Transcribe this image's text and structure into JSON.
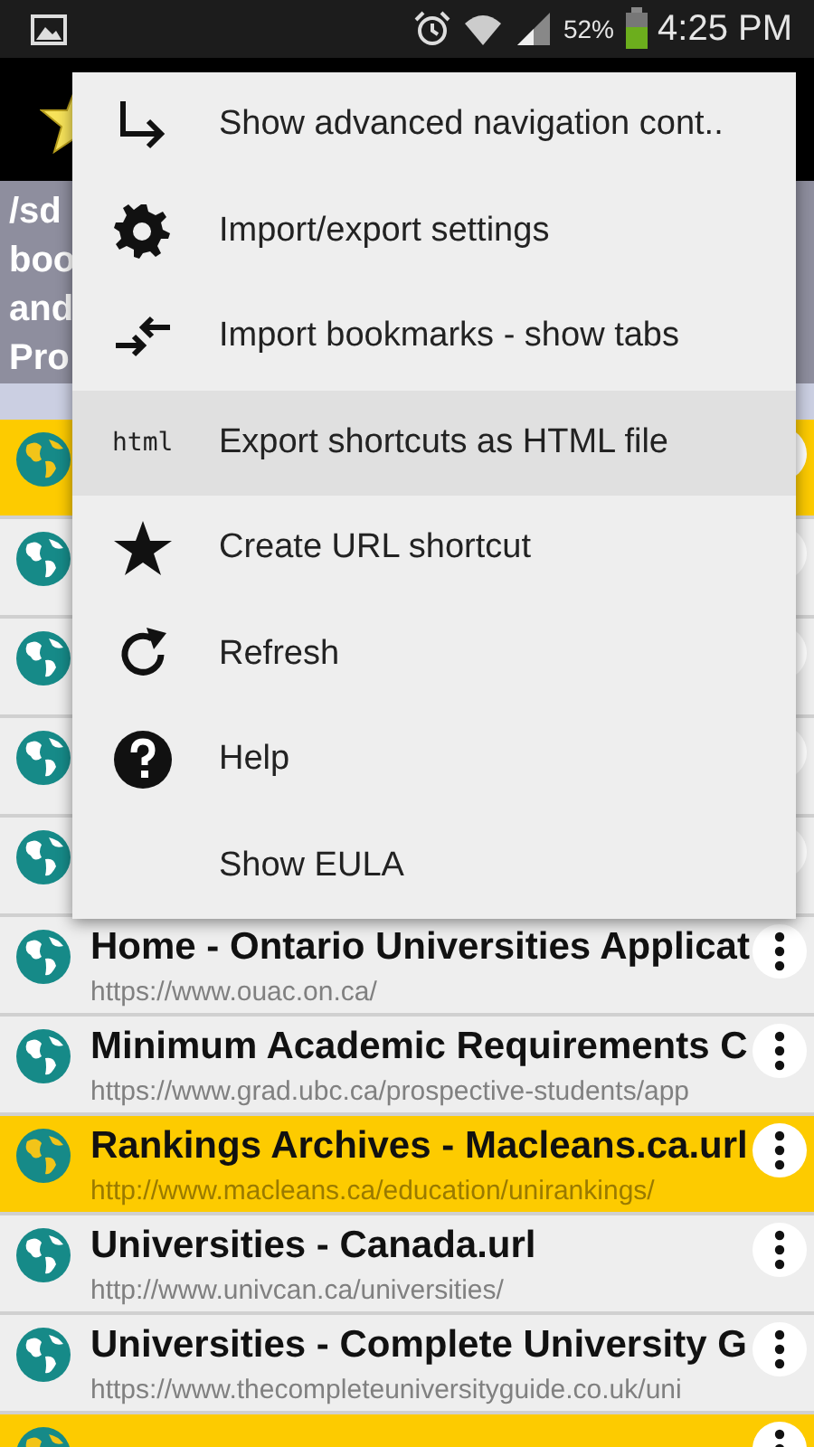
{
  "status_bar": {
    "battery_text": "52%",
    "time": "4:25 PM"
  },
  "header": {
    "lines": [
      "/sd",
      "boo",
      "and",
      "Pro"
    ]
  },
  "rows": [
    {
      "highlighted": true
    },
    {
      "highlighted": false
    },
    {
      "highlighted": false
    },
    {
      "highlighted": false
    },
    {
      "highlighted": false
    },
    {
      "title": "Home - Ontario Universities Applicat",
      "url": "https://www.ouac.on.ca/",
      "highlighted": false
    },
    {
      "title": "Minimum Academic Requirements C",
      "url": "https://www.grad.ubc.ca/prospective-students/app",
      "highlighted": false
    },
    {
      "title": "Rankings Archives - Macleans.ca.url",
      "url": "http://www.macleans.ca/education/unirankings/",
      "highlighted": true
    },
    {
      "title": "Universities - Canada.url",
      "url": "http://www.univcan.ca/universities/",
      "highlighted": false
    },
    {
      "title": "Universities - Complete University G",
      "url": "https://www.thecompleteuniversityguide.co.uk/uni",
      "highlighted": false
    },
    {
      "highlighted": true
    }
  ],
  "menu": {
    "items": [
      {
        "kind": "arrow",
        "label": "Show advanced navigation cont..",
        "selected": false
      },
      {
        "kind": "gear",
        "label": "Import/export settings",
        "selected": false
      },
      {
        "kind": "swap",
        "label": "Import bookmarks - show tabs",
        "selected": false
      },
      {
        "kind": "text",
        "icon_text": "html",
        "label": "Export shortcuts as HTML file",
        "selected": true
      },
      {
        "kind": "star",
        "label": "Create URL shortcut",
        "selected": false
      },
      {
        "kind": "refresh",
        "label": "Refresh",
        "selected": false
      },
      {
        "kind": "help",
        "label": "Help",
        "selected": false
      },
      {
        "kind": "plain",
        "label": "Show EULA",
        "selected": false
      }
    ]
  }
}
